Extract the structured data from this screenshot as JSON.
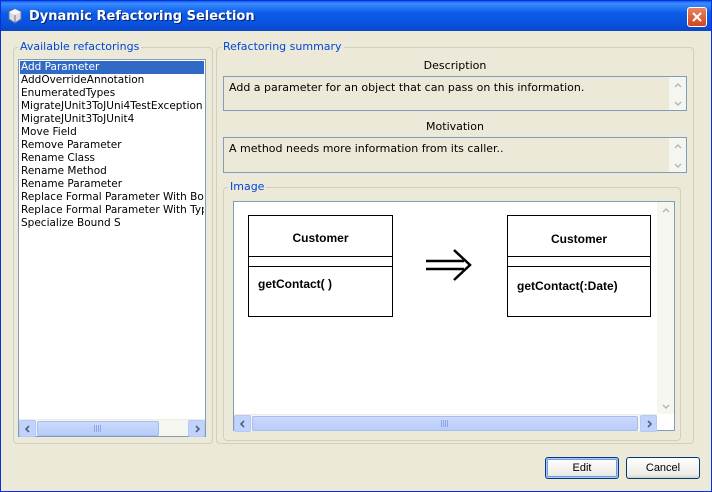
{
  "window": {
    "title": "Dynamic Refactoring Selection",
    "icons": {
      "app": "gear-app-icon",
      "close": "close-icon"
    }
  },
  "available": {
    "label": "Available refactorings",
    "items": [
      "Add Parameter",
      "AddOverrideAnnotation",
      "EnumeratedTypes",
      "MigrateJUnit3ToJUni4TestException",
      "MigrateJUnit3ToJUnit4",
      "Move Field",
      "Remove Parameter",
      "Rename Class",
      "Rename Method",
      "Rename Parameter",
      "Replace Formal Parameter With Bound",
      "Replace Formal Parameter With Type",
      "Specialize Bound S"
    ],
    "selected_index": 0
  },
  "summary": {
    "label": "Refactoring summary",
    "description_title": "Description",
    "description_text": "Add a parameter for an object that can pass on this information.",
    "motivation_title": "Motivation",
    "motivation_text": "A method needs more information from its caller..",
    "image_label": "Image"
  },
  "diagram": {
    "before": {
      "class_name": "Customer",
      "operation": "getContact( )"
    },
    "after": {
      "class_name": "Customer",
      "operation": "getContact(:Date)"
    },
    "arrow_icon": "double-arrow-right-icon"
  },
  "buttons": {
    "edit": "Edit",
    "cancel": "Cancel"
  },
  "colors": {
    "accent": "#316ac5",
    "titlebar": "#0a5ef2",
    "group_label": "#0046d5"
  }
}
